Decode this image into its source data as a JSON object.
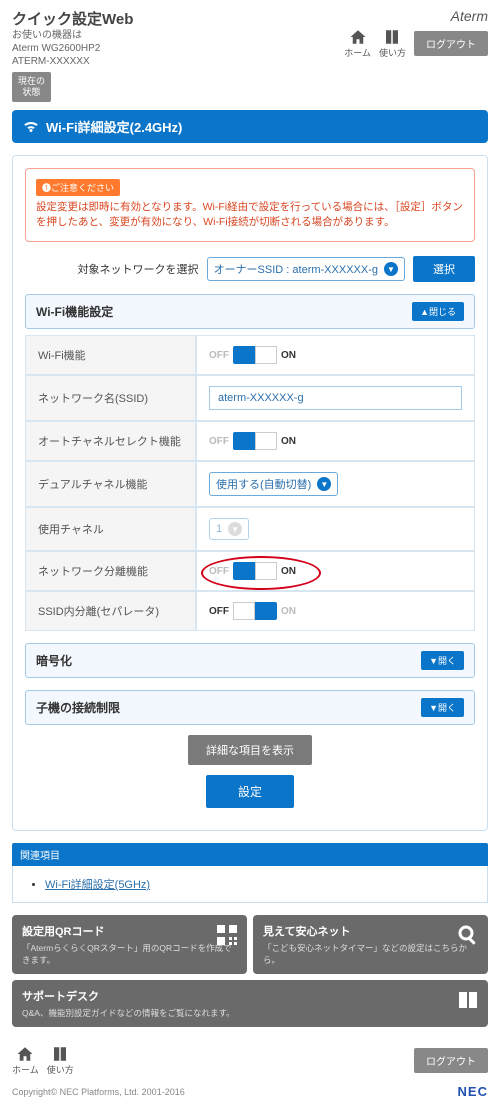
{
  "header": {
    "title": "クイック設定Web",
    "sub1": "お使いの機器は",
    "sub2": "Aterm WG2600HP2",
    "sub3": "ATERM-XXXXXX",
    "status": "現在の\n状態",
    "brand": "Aterm",
    "home": "ホーム",
    "help": "使い方",
    "logout": "ログアウト"
  },
  "page_title": "Wi-Fi詳細設定(2.4GHz)",
  "warning": {
    "tag": "❶ご注意ください",
    "text": "設定変更は即時に有効となります。Wi-Fi経由で設定を行っている場合には、［設定］ボタンを押したあと、変更が有効になり、Wi-Fi接続が切断される場合があります。"
  },
  "network_select": {
    "label": "対象ネットワークを選択",
    "value": "オーナーSSID : aterm-XXXXXX-g",
    "button": "選択"
  },
  "sections": {
    "wifi": {
      "title": "Wi-Fi機能設定",
      "btn": "▲閉じる"
    },
    "encrypt": {
      "title": "暗号化",
      "btn": "▼開く"
    },
    "restrict": {
      "title": "子機の接続制限",
      "btn": "▼開く"
    }
  },
  "rows": {
    "wifi_func": "Wi-Fi機能",
    "ssid": "ネットワーク名(SSID)",
    "ssid_value": "aterm-XXXXXX-g",
    "auto_ch": "オートチャネルセレクト機能",
    "dual_ch": "デュアルチャネル機能",
    "dual_ch_value": "使用する(自動切替)",
    "use_ch": "使用チャネル",
    "use_ch_value": "1",
    "net_sep": "ネットワーク分離機能",
    "ssid_sep": "SSID内分離(セパレータ)",
    "off": "OFF",
    "on": "ON"
  },
  "buttons": {
    "detail": "詳細な項目を表示",
    "apply": "設定"
  },
  "related": {
    "title": "関連項目",
    "link": "Wi-Fi詳細設定(5GHz)"
  },
  "cards": {
    "qr_title": "設定用QRコード",
    "qr_sub": "「AtermらくらくQRスタート」用のQRコードを作成できます。",
    "safe_title": "見えて安心ネット",
    "safe_sub": "「こども安心ネットタイマー」などの設定はこちらから。",
    "support_title": "サポートデスク",
    "support_sub": "Q&A、機能別設定ガイドなどの情報をご覧になれます。"
  },
  "footer": {
    "home": "ホーム",
    "help": "使い方",
    "logout": "ログアウト",
    "copyright": "Copyright© NEC Platforms, Ltd. 2001-2016",
    "nec": "NEC"
  }
}
